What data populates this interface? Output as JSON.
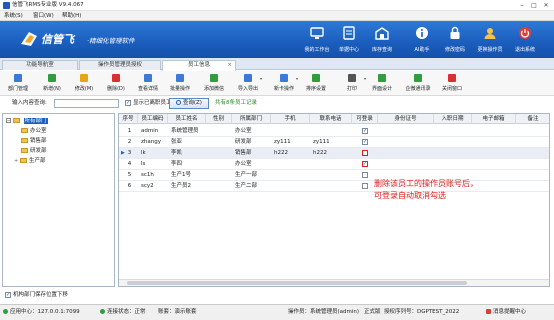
{
  "window": {
    "title": "信管飞RMS专业版 V9.4.067",
    "min": "–",
    "max": "□",
    "close": "✕"
  },
  "menu": [
    "系统(S)",
    "窗口(W)",
    "帮助(H)"
  ],
  "banner": {
    "logo_cn": "信管飞",
    "logo_sub": "·精细化管理软件",
    "buttons": [
      "我的工作台",
      "单据中心",
      "库存查询",
      "AI助手",
      "修改密码",
      "更换操作员",
      "退出系统"
    ]
  },
  "tabs": [
    {
      "label": "功能导航室"
    },
    {
      "label": "操作员管理员授权"
    },
    {
      "label": "员工信息",
      "close": "×"
    }
  ],
  "toolbar": [
    {
      "label": "部门管理",
      "color": "#3a7bd5"
    },
    {
      "label": "新增(N)",
      "color": "#2e9e3e"
    },
    {
      "label": "修改(M)",
      "color": "#e8a317"
    },
    {
      "label": "删除(D)",
      "color": "#d83030"
    },
    {
      "label": "查看详情",
      "color": "#3a7bd5"
    },
    {
      "label": "批量操作",
      "color": "#3a7bd5"
    },
    {
      "label": "添加微信",
      "color": "#2e9e3e"
    },
    {
      "label": "导入导出",
      "color": "#3a7bd5",
      "dropdown": true
    },
    {
      "label": "新卡操作",
      "color": "#3a7bd5",
      "dropdown": true
    },
    {
      "label": "排序设置",
      "color": "#2e9e3e"
    },
    {
      "label": "打印",
      "color": "#555555",
      "dropdown": true
    },
    {
      "label": "界面设计",
      "color": "#2e9e3e"
    },
    {
      "label": "企微通讯录",
      "color": "#2e9e3e"
    },
    {
      "label": "关闭窗口",
      "color": "#d83030"
    }
  ],
  "search": {
    "label": "输入内容查询:",
    "value": "",
    "show_left_label": "显示已离职员工",
    "show_left_checked": true,
    "query_button": "查询(Z)",
    "record_hint": "共有8条员工记录"
  },
  "tree": {
    "root": "所有部门",
    "children": [
      "办公室",
      "销售部",
      "研发部",
      "生产部"
    ],
    "bottom_checkbox": "机构部门保存位置下移",
    "bottom_checked": true
  },
  "table": {
    "columns": [
      "序号",
      "员工编码",
      "员工姓名",
      "性别",
      "所属部门",
      "手机",
      "联系电话",
      "可登录",
      "身份证号",
      "入职日期",
      "电子邮箱",
      "备注"
    ],
    "rows": [
      {
        "no": "1",
        "code": "admin",
        "name": "系统管理员",
        "gender": "",
        "dept": "办公室",
        "mobile": "",
        "phone": "",
        "login": true
      },
      {
        "no": "2",
        "code": "zhangy",
        "name": "张亚",
        "gender": "",
        "dept": "研发部",
        "mobile": "zy111",
        "phone": "zy111",
        "login": true
      },
      {
        "no": "3",
        "code": "lk",
        "name": "李凯",
        "gender": "",
        "dept": "销售部",
        "mobile": "h222",
        "phone": "h222",
        "login": false
      },
      {
        "no": "4",
        "code": "ls",
        "name": "李四",
        "gender": "",
        "dept": "办公室",
        "mobile": "",
        "phone": "",
        "login": true
      },
      {
        "no": "5",
        "code": "sc1h",
        "name": "生产1号",
        "gender": "",
        "dept": "生产一部",
        "mobile": "",
        "phone": "",
        "login": false
      },
      {
        "no": "6",
        "code": "scy2",
        "name": "生产员2",
        "gender": "",
        "dept": "生产二部",
        "mobile": "",
        "phone": "",
        "login": false
      }
    ]
  },
  "annotation": {
    "line1": "删除该员工的操作员账号后，",
    "line2": "可登录自动取消勾选"
  },
  "statusbar": {
    "server": "应用中心：127.0.0.1:7099",
    "connection": "连接状态：正常",
    "account": "账套：演示账套",
    "operator": "操作员：系统管理员(admin)",
    "edition": "正式版",
    "serial": "授权序列号：DGPTEST_2022",
    "message": "消息提醒中心"
  },
  "colors": {
    "banner": "#1d5fbf",
    "annotation": "#e01818",
    "hint": "#2a8a2a"
  }
}
